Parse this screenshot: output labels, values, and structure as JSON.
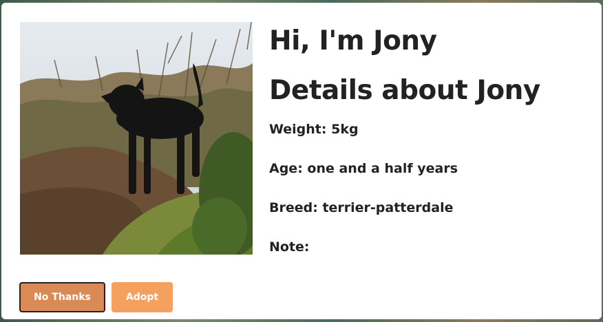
{
  "pet": {
    "greeting": "Hi, I'm Jony",
    "details_heading": "Details about Jony",
    "weight": "Weight: 5kg",
    "age": "Age: one and a half years",
    "breed": "Breed: terrier-patterdale",
    "note": "Note:"
  },
  "actions": {
    "no_thanks_label": "No Thanks",
    "adopt_label": "Adopt"
  },
  "colors": {
    "no_thanks_bg": "#d98a55",
    "adopt_bg": "#f5a05e",
    "text": "#222222"
  }
}
